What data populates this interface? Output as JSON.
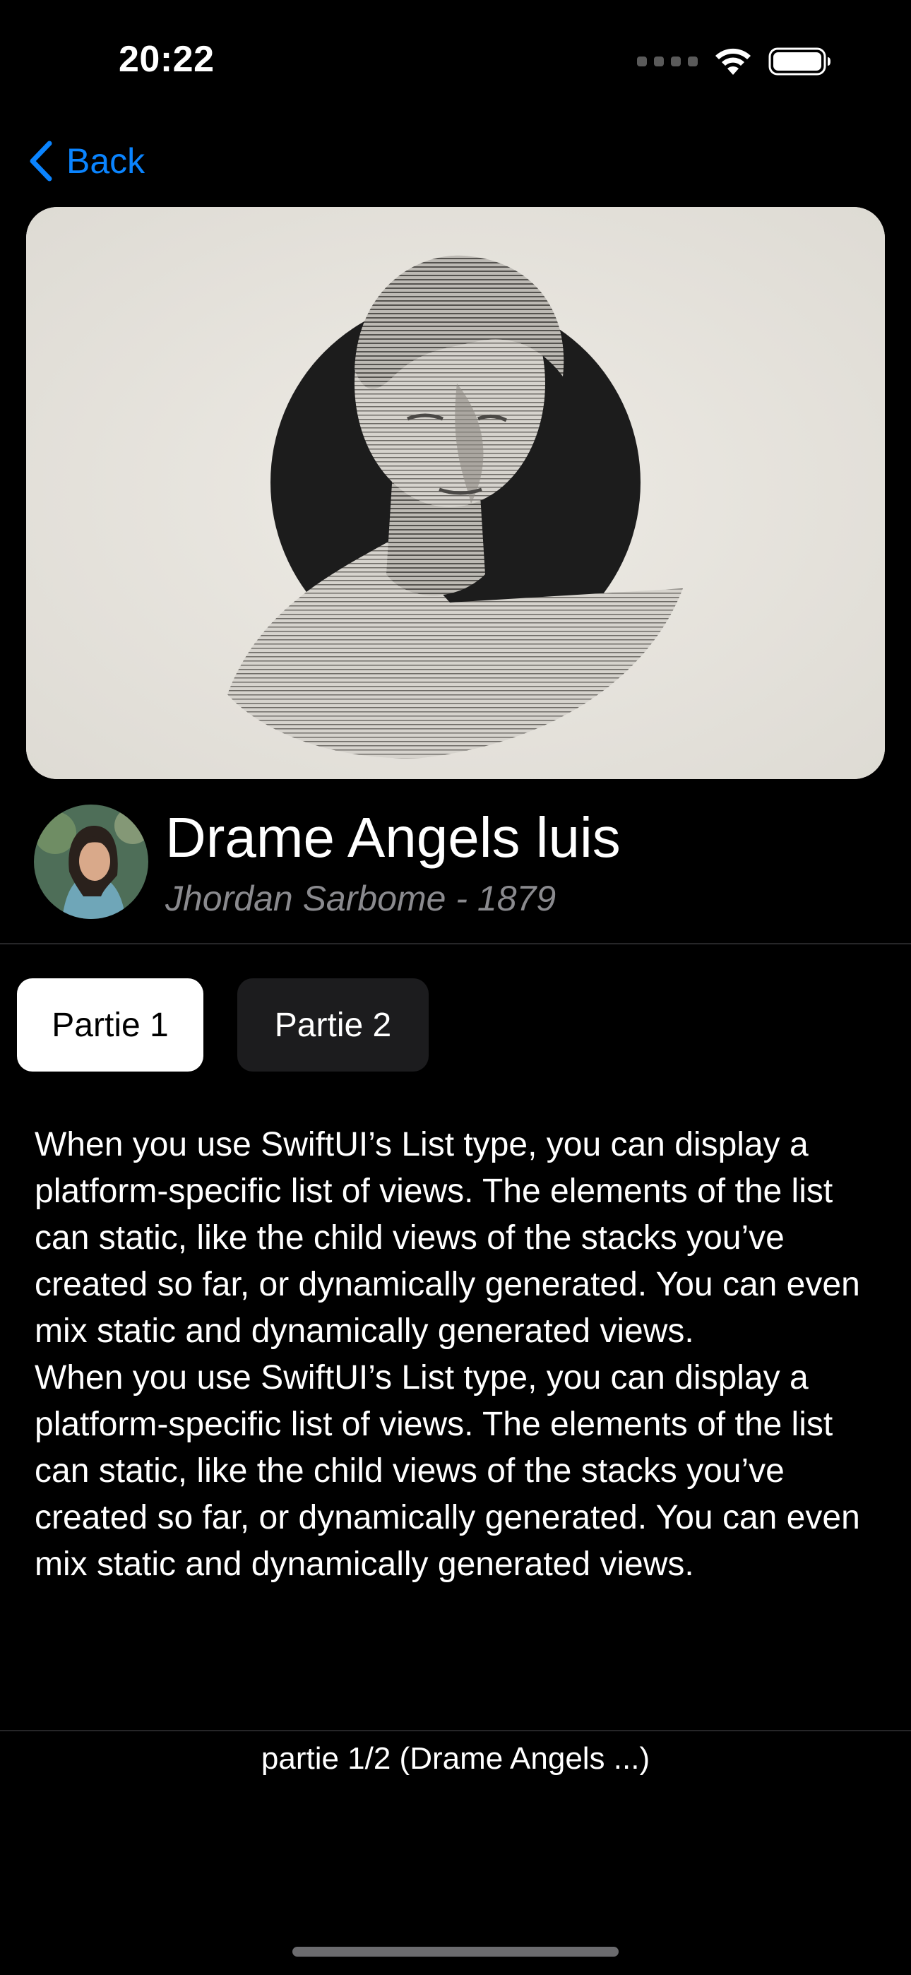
{
  "status_bar": {
    "time": "20:22",
    "icons": [
      "cellular-signal-icon",
      "wifi-icon",
      "battery-icon"
    ]
  },
  "nav": {
    "back_label": "Back",
    "accent_color": "#0a84ff"
  },
  "hero": {
    "image": "statue-bust-artwork"
  },
  "header": {
    "title": "Drame Angels luis",
    "subtitle": "Jhordan Sarbome - 1879"
  },
  "tabs": [
    {
      "label": "Partie 1",
      "selected": true
    },
    {
      "label": "Partie 2",
      "selected": false
    }
  ],
  "content": {
    "paragraphs": [
      "When you use SwiftUI’s List type, you can display a platform-specific list of views. The elements of the list can static, like the child views of the stacks you’ve created so far, or dynamically generated. You can even mix static and dynamically generated views.",
      "When you use SwiftUI’s List type, you can display a platform-specific list of views. The elements of the list can static, like the child views of the stacks you’ve created so far, or dynamically generated. You can even mix static and dynamically generated views."
    ]
  },
  "footer": {
    "status": "partie 1/2 (Drame Angels ...)"
  }
}
